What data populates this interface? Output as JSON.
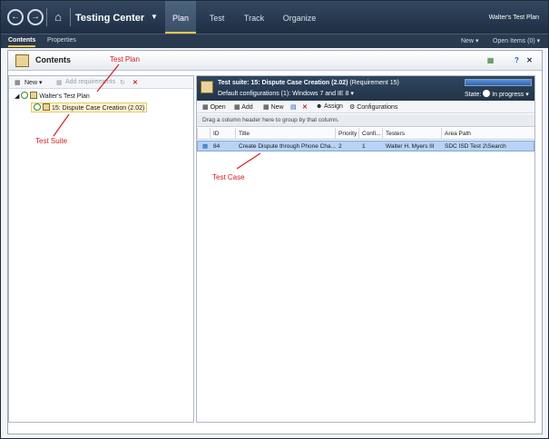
{
  "topbar": {
    "back_icon": "back-arrow-icon",
    "forward_icon": "forward-arrow-icon",
    "home_icon": "home-icon",
    "app_title": "Testing Center",
    "tabs": [
      {
        "label": "Plan",
        "active": true
      },
      {
        "label": "Test",
        "active": false
      },
      {
        "label": "Track",
        "active": false
      },
      {
        "label": "Organize",
        "active": false
      }
    ],
    "plan_name": "Walter's Test Plan"
  },
  "subbar": {
    "tabs": [
      {
        "label": "Contents",
        "active": true
      },
      {
        "label": "Properties",
        "active": false
      }
    ],
    "new_label": "New",
    "open_items_label": "Open Items (0)"
  },
  "contents": {
    "title": "Contents"
  },
  "left": {
    "toolbar": {
      "new_label": "New",
      "add_requirements_label": "Add requirements"
    },
    "tree": {
      "root_label": "Walter's Test Plan",
      "child_label": "15: Dispute Case Creation (2.02)"
    }
  },
  "right": {
    "suite": {
      "prefix": "Test suite:",
      "name": "15: Dispute Case Creation (2.02)",
      "requirement": "(Requirement 15)",
      "config_label": "Default configurations (1):",
      "config_value": "Windows 7 and IE 8",
      "state_label": "State:",
      "state_value": "In progress",
      "progress": 1.0
    },
    "toolbar": {
      "open_label": "Open",
      "add_label": "Add",
      "new_label": "New",
      "assign_label": "Assign",
      "configurations_label": "Configurations"
    },
    "group_hint": "Drag a column header here to group by that column.",
    "columns": [
      "ID",
      "Title",
      "Priority",
      "Confi...",
      "Testers",
      "Area Path"
    ],
    "rows": [
      {
        "id": "84",
        "title": "Create Dispute through Phone Cha...",
        "priority": "2",
        "config": "1",
        "testers": "Walter H. Myers III",
        "area_path": "SDC ISD Test 2\\Search"
      }
    ]
  },
  "annotations": {
    "test_plan": "Test Plan",
    "test_suite": "Test Suite",
    "test_case": "Test Case"
  },
  "colors": {
    "nav_bg": "#2a3b51",
    "accent": "#f0c84a",
    "selection": "#b8d3f3",
    "annotation": "#d22020"
  }
}
